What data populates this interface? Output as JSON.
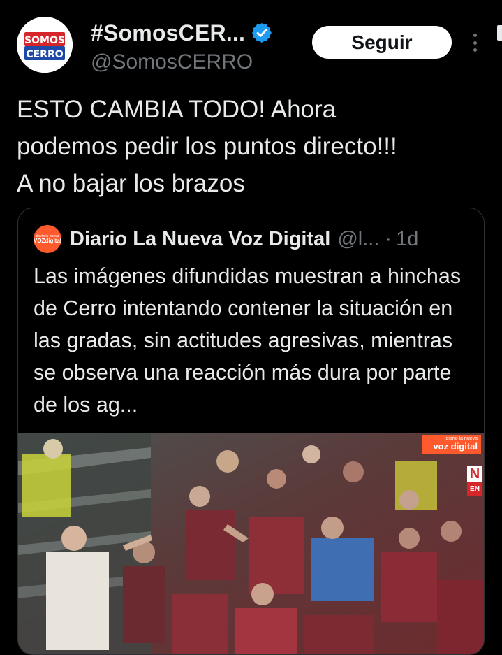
{
  "header": {
    "display_name": "#SomosCER...",
    "handle": "@SomosCERRO",
    "follow_label": "Seguir",
    "avatar_line1": "SOMOS",
    "avatar_line2": "CERRO"
  },
  "tweet": {
    "text": "ESTO CAMBIA TODO! Ahora\npodemos pedir los puntos directo!!!\nA no bajar los brazos"
  },
  "quote": {
    "avatar_top": "diario la nueva",
    "avatar_bottom": "VOZdigital",
    "name": "Diario La Nueva Voz Digital",
    "handle": "@l...",
    "separator": "·",
    "time": "1d",
    "text": "Las imágenes difundidas muestran a hinchas de Cerro intentando contener la situación en las gradas, sin actitudes agresivas, mientras se observa una reacción más dura por parte de los ag...",
    "media": {
      "watermark_top": "diario la nueva",
      "watermark_bottom": "voz digital",
      "badge_top": "N",
      "badge_bottom": "EN"
    }
  },
  "colors": {
    "background": "#000000",
    "text": "#e7e9ea",
    "secondary_text": "#71767b",
    "verified_blue": "#1d9bf0",
    "brand_orange": "#ff5a2e",
    "cerro_blue": "#1f4aa8",
    "cerro_red": "#d6262a",
    "follow_button_bg": "#ffffff"
  },
  "icons": {
    "verified": "verified-badge-icon",
    "more": "more-options-icon"
  }
}
